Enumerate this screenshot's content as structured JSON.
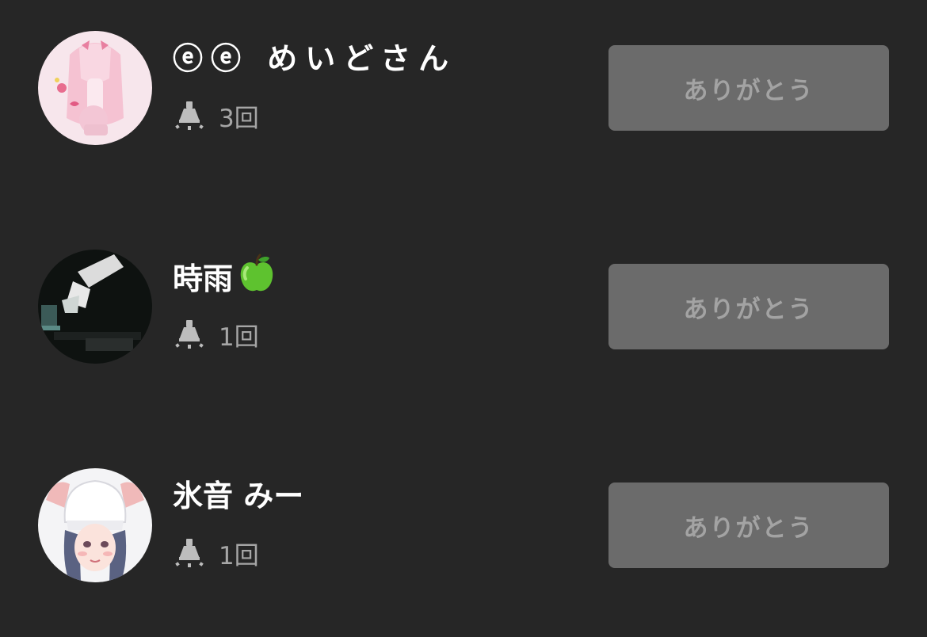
{
  "supporters": [
    {
      "name": "ⓔⓔ めいどさん",
      "count": "3回",
      "avatar": "pink-anime-girl-avatar"
    },
    {
      "name": "時雨",
      "name_emoji": "green-apple-icon",
      "count": "1回",
      "avatar": "dark-hand-avatar"
    },
    {
      "name": "氷音 みー",
      "count": "1回",
      "avatar": "white-beanie-girl-avatar"
    }
  ],
  "thanks_label": "ありがとう",
  "count_icon": "spotlight-icon",
  "colors": {
    "background": "#262626",
    "name_text": "#ffffff",
    "count_text": "#a6a6a6",
    "button_bg": "#6b6b6b",
    "button_text": "#a3a3a3"
  }
}
